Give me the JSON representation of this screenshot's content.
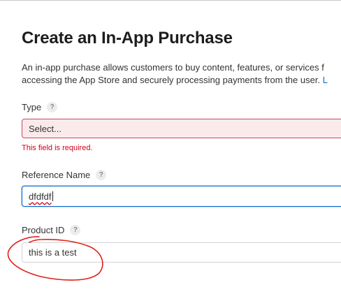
{
  "page": {
    "title": "Create an In-App Purchase",
    "description_line1": "An in-app purchase allows customers to buy content, features, or services f",
    "description_line2": "accessing the App Store and securely processing payments from the user. ",
    "description_link": "L"
  },
  "form": {
    "type": {
      "label": "Type",
      "help": "?",
      "value": "Select...",
      "error": "This field is required."
    },
    "reference_name": {
      "label": "Reference Name",
      "help": "?",
      "value": "dfdfdf"
    },
    "product_id": {
      "label": "Product ID",
      "help": "?",
      "value": "this is a test"
    }
  },
  "annotation": {
    "color": "#e0201b",
    "shape": "hand-drawn-circle"
  }
}
